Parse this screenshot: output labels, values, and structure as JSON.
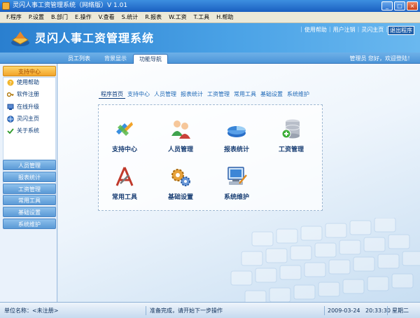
{
  "window": {
    "title": "灵闪人事工资管理系统（网络版）V 1.01"
  },
  "menu": [
    {
      "label": "F.程序"
    },
    {
      "label": "P.设置"
    },
    {
      "label": "B.部门"
    },
    {
      "label": "E.操作"
    },
    {
      "label": "V.查看"
    },
    {
      "label": "S.统计"
    },
    {
      "label": "R.报表"
    },
    {
      "label": "W.工资"
    },
    {
      "label": "T.工具"
    },
    {
      "label": "H.帮助"
    }
  ],
  "header": {
    "app_name": "灵闪人事工资管理系统",
    "links": {
      "help": "使用帮助",
      "logout": "用户注销",
      "home": "灵闪主页",
      "exit": "退出程序"
    }
  },
  "tabs": {
    "employee_list": "员工列表",
    "background": "背景显示",
    "nav": "功能导航"
  },
  "user_greeting": "管理员 您好，欢迎登陆！",
  "sidebar": {
    "support_head": "支持中心",
    "support_items": [
      {
        "label": "使用帮助",
        "icon": "help-icon"
      },
      {
        "label": "软件注册",
        "icon": "key-icon"
      },
      {
        "label": "在线升级",
        "icon": "upgrade-icon"
      },
      {
        "label": "灵闪主页",
        "icon": "globe-icon"
      },
      {
        "label": "关于系统",
        "icon": "check-icon"
      }
    ],
    "sections": [
      "人员管理",
      "报表统计",
      "工资管理",
      "常用工具",
      "基础设置",
      "系统维护"
    ]
  },
  "navbar": [
    "程序首页",
    "支持中心",
    "人员管理",
    "报表统计",
    "工资管理",
    "常用工具",
    "基础设置",
    "系统维护"
  ],
  "functions": [
    {
      "label": "支持中心",
      "icon": "support-center-icon"
    },
    {
      "label": "人员管理",
      "icon": "people-icon"
    },
    {
      "label": "报表统计",
      "icon": "chart-icon"
    },
    {
      "label": "工资管理",
      "icon": "database-icon"
    },
    {
      "label": "常用工具",
      "icon": "tools-icon"
    },
    {
      "label": "基础设置",
      "icon": "gears-icon"
    },
    {
      "label": "系统维护",
      "icon": "maintenance-icon"
    }
  ],
  "status": {
    "unit": "单位名称：<未注册>",
    "message": "准备完成，请开始下一步操作",
    "date": "2009-03-24",
    "time": "20:33:30",
    "weekday": "星期二"
  }
}
